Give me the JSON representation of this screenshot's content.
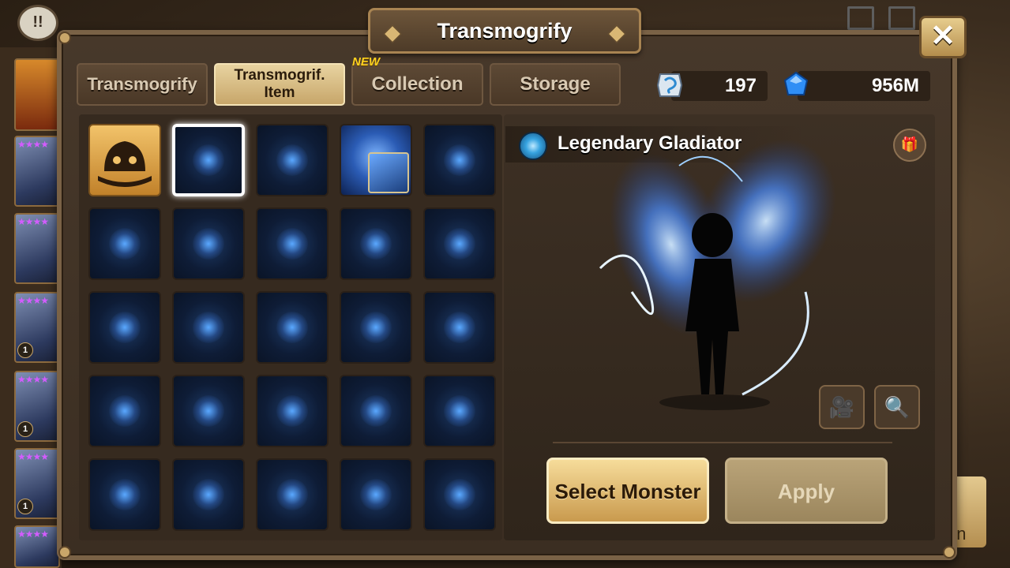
{
  "window": {
    "title": "Transmogrify"
  },
  "top_left": {
    "chat_icon": "!!"
  },
  "tabs": [
    {
      "label": "Transmogrify",
      "active": false
    },
    {
      "label": "Transmogrif. Item",
      "active": true
    },
    {
      "label": "Collection",
      "active": false,
      "badge": "NEW"
    },
    {
      "label": "Storage",
      "active": false
    }
  ],
  "currency": {
    "crystals_special": {
      "icon": "transmog-stone-icon",
      "value": "197"
    },
    "mana": {
      "icon": "blue-crystal-icon",
      "value": "956M"
    }
  },
  "items_grid": {
    "rows": 5,
    "cols": 5,
    "selected_index": 1,
    "cells": [
      "gold-helmet",
      "wing-effect",
      "wing-effect-small",
      "lightning-effect",
      "glow-effect",
      "orb-effect",
      "sparkle-effect",
      "mist-effect",
      "ghost-effect",
      "smoke-effect",
      "hearts-effect",
      "bubbles-effect",
      "stars-effect",
      "twinkle-effect",
      "flame-effect",
      "rain-effect",
      "tornado-effect",
      "dragon-effect",
      "fish-effect",
      "vortex-effect",
      "aura-effect",
      "meditation-effect",
      "grass-effect",
      "ring-effect",
      "burst-effect"
    ]
  },
  "preview": {
    "item_name": "Legendary Gladiator",
    "info_icon": "gift-icon"
  },
  "tools": {
    "video_icon": "video-camera-icon",
    "zoom_icon": "zoom-in-icon"
  },
  "buttons": {
    "select_monster": "Select Monster",
    "apply": "Apply"
  },
  "sidebar": {
    "stars": "★★★★",
    "levels": [
      "",
      "",
      "1",
      "1",
      "1"
    ]
  },
  "right_peek": {
    "text": "on"
  }
}
